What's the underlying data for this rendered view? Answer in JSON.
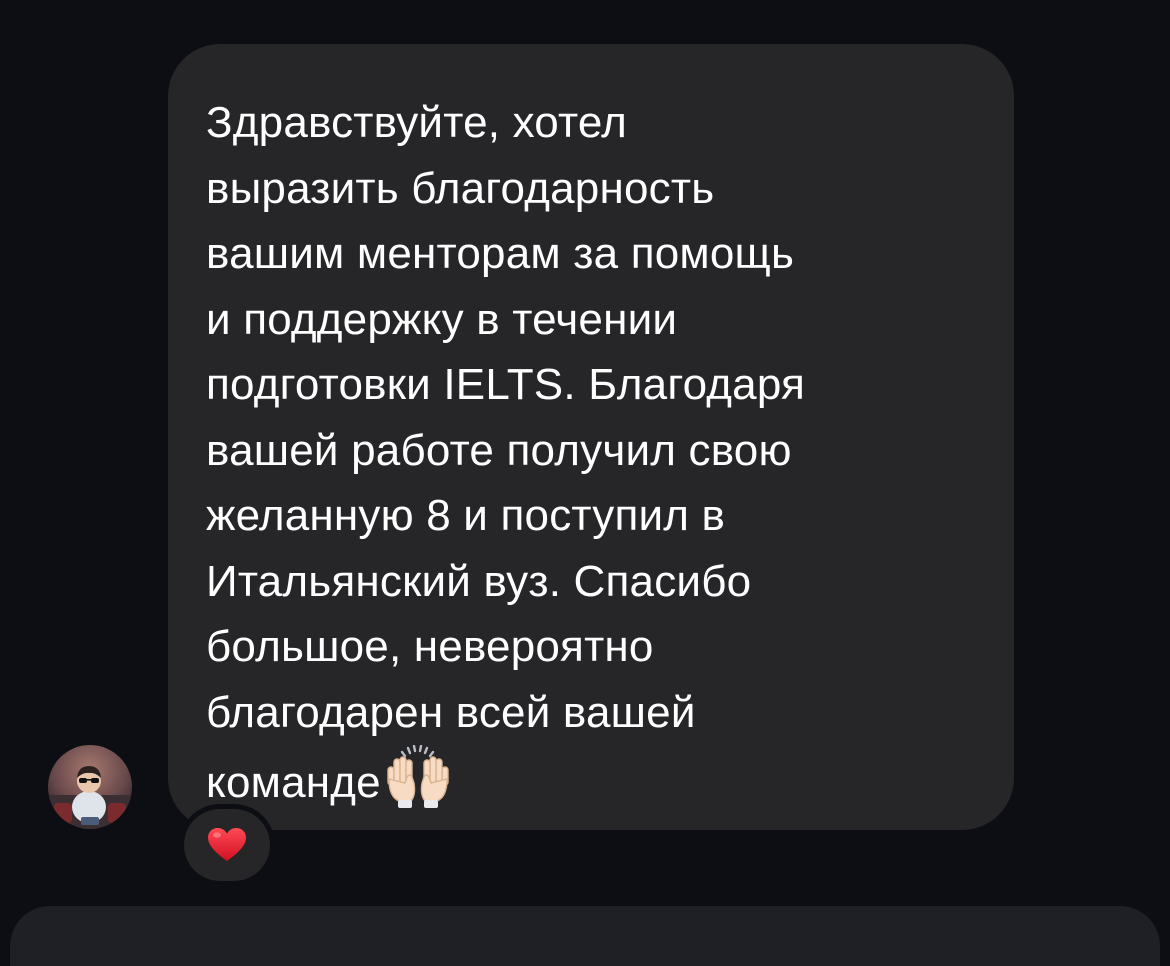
{
  "chat": {
    "message": {
      "text": "Здравствуйте, хотел\nвыразить благодарность\nвашим менторам за помощь\nи поддержку в течении\nподготовки IELTS. Благодаря\nвашей работе получил свою\nжеланную 8 и поступил в\nИтальянский вуз. Спасибо\nбольшое, невероятно\nблагодарен всей вашей\nкоманде",
      "trailing_emoji": "raised-hands-emoji",
      "reaction": "red-heart-emoji"
    }
  },
  "colors": {
    "background": "#0c0e13",
    "bubble": "#262629",
    "text": "#ffffff",
    "reaction_heart": "#e8202e"
  }
}
